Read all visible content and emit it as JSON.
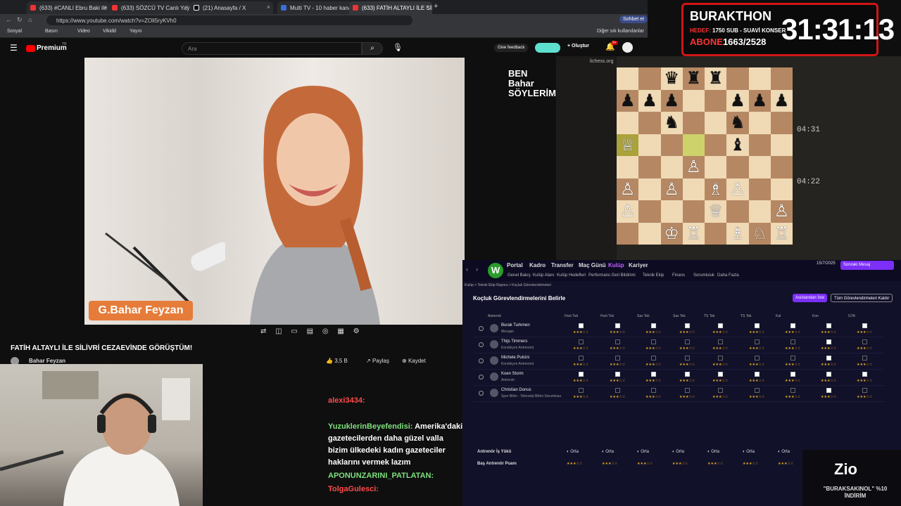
{
  "browser": {
    "tabs": [
      {
        "title": "(633) #CANLI Ebru Baki ile Para Sp"
      },
      {
        "title": "(633) SÖZCÜ TV Canlı Yayını"
      },
      {
        "title": "(21) Anasayfa / X"
      },
      {
        "title": "Multi TV - 10 haber kanalını aynı"
      },
      {
        "title": "(633) FATİH ALTAYLI İLE SİLİ"
      }
    ],
    "url": "https://www.youtube.com/watch?v=ZOli5ryKVh0",
    "bookmarks": [
      "Sosyal",
      "Basın",
      "Video",
      "Vikidd",
      "Yayın"
    ],
    "other_bookmarks": "Diğer sık kullanılanlar",
    "profile_label": "Sohbet et"
  },
  "youtube": {
    "logo": "Premium",
    "logo_sup": "TR",
    "search_placeholder": "Ara",
    "give_feedback": "Give feedback",
    "create": "Oluştur",
    "notif_count": "9+",
    "video_title": "FATİH ALTAYLI İLE SİLİVRİ CEZAEVİNDE GÖRÜŞTÜM!",
    "channel": "Bahar Feyzan",
    "likes": "3,5 B",
    "share": "Paylaş",
    "save": "Kaydet",
    "name_tag": "G.Bahar Feyzan",
    "ben_logo": "BEN Bahar SÖYLERİM."
  },
  "overlay": {
    "title": "BURAKTHON",
    "hedef_label": "HEDEF:",
    "hedef_value": "1750 SUB - SUAVİ KONSER",
    "abone_label": "ABONE",
    "abone_value": "1663/2528",
    "timer": "31:31:13"
  },
  "chess": {
    "site": "lichess.org",
    "clock_top": "04:31",
    "clock_bottom": "04:22",
    "board": [
      [
        "",
        "",
        "♛",
        "♜",
        "♜",
        "",
        "",
        ""
      ],
      [
        "♟",
        "♟",
        "♟",
        "",
        "",
        "♟",
        "♟",
        "♟"
      ],
      [
        "",
        "",
        "♞",
        "",
        "",
        "♞",
        "",
        ""
      ],
      [
        "♕",
        "",
        "",
        "",
        "",
        "♝",
        "",
        ""
      ],
      [
        "",
        "",
        "",
        "♙",
        "",
        "",
        "",
        ""
      ],
      [
        "♙",
        "",
        "♙",
        "",
        "♗",
        "♙",
        "",
        ""
      ],
      [
        "♙",
        "",
        "",
        "",
        "♕",
        "",
        "",
        "♙"
      ],
      [
        "",
        "",
        "♔",
        "♖",
        "",
        "♗",
        "♘",
        "♖"
      ]
    ]
  },
  "chat": [
    {
      "user": "alexi3434:",
      "text": "",
      "color": "#ff4a4a"
    },
    {
      "user": "YuzuklerinBeyefendisi:",
      "text": "Amerika'daki gazetecilerden daha güzel valla bizim ülkedeki kadın gazeteciler haklarını vermek lazım",
      "color": "#7ee07e"
    },
    {
      "user": "APONUNZARINI_PATLATAN:",
      "text": "",
      "color": "#7ee07e"
    },
    {
      "user": "TolgaGulesci:",
      "text": "",
      "color": "#ff4a4a"
    }
  ],
  "fm": {
    "nav": [
      "Portal",
      "Kadro",
      "Transfer",
      "Maç Günü",
      "Kulüp",
      "Kariyer"
    ],
    "subnav": [
      "Genel Bakış",
      "Kulüp Alanı",
      "Kulüp Hedefleri",
      "Performans Geri Bildirimi",
      "Teknik Ekip",
      "Finans",
      "Sorumluluk",
      "Daha Fazla"
    ],
    "breadcrumb": "Kulüp > Teknik Ekip Raporu > Koçluk Görevlendirmeleri",
    "date": "15/7/2025",
    "continue": "Sonraki Mesaj",
    "title": "Koçluk Görevlendirmelerini Belirle",
    "btn_assistant": "Asistandan İste",
    "btn_remove": "Tüm Görevlendirmeleri Kaldır",
    "columns": [
      "Antrenör",
      "Hızlı Tek",
      "Hızlı Tek",
      "Sav Tek",
      "Sav Tek",
      "TS Tek",
      "TS Tek",
      "Kal",
      "Kon",
      "GTA"
    ],
    "coaches": [
      {
        "name": "Burak Turkmen",
        "role": "Menajer",
        "checks": [
          1,
          1,
          1,
          1,
          1,
          1,
          1,
          1,
          1
        ]
      },
      {
        "name": "Thijs Timmers",
        "role": "Kondisyon Antrenörü",
        "checks": [
          0,
          0,
          0,
          0,
          0,
          0,
          0,
          1,
          0
        ]
      },
      {
        "name": "Michele Pulcini",
        "role": "Kondisyon Antrenörü",
        "checks": [
          0,
          0,
          0,
          0,
          0,
          0,
          0,
          1,
          0
        ]
      },
      {
        "name": "Koen Storm",
        "role": "Antrenör",
        "checks": [
          1,
          1,
          1,
          1,
          1,
          1,
          1,
          1,
          1
        ]
      },
      {
        "name": "Christian Donus",
        "role": "Spor Bilim - Teknoloji Bilimi Sorumlusu",
        "checks": [
          0,
          0,
          0,
          0,
          0,
          0,
          0,
          1,
          0
        ]
      }
    ],
    "footer_rows": [
      "Antrenör İş Yükü",
      "Baş Antrenör Puanı"
    ],
    "workload": "Orta",
    "sponsor_logo": "Zio",
    "sponsor_text": "\"BURAKSAKINOL\" %10 İNDİRİM"
  },
  "colors": {
    "accent_red": "#d01515",
    "fm_purple": "#7b2ff7",
    "yt_red": "#ff0000"
  }
}
